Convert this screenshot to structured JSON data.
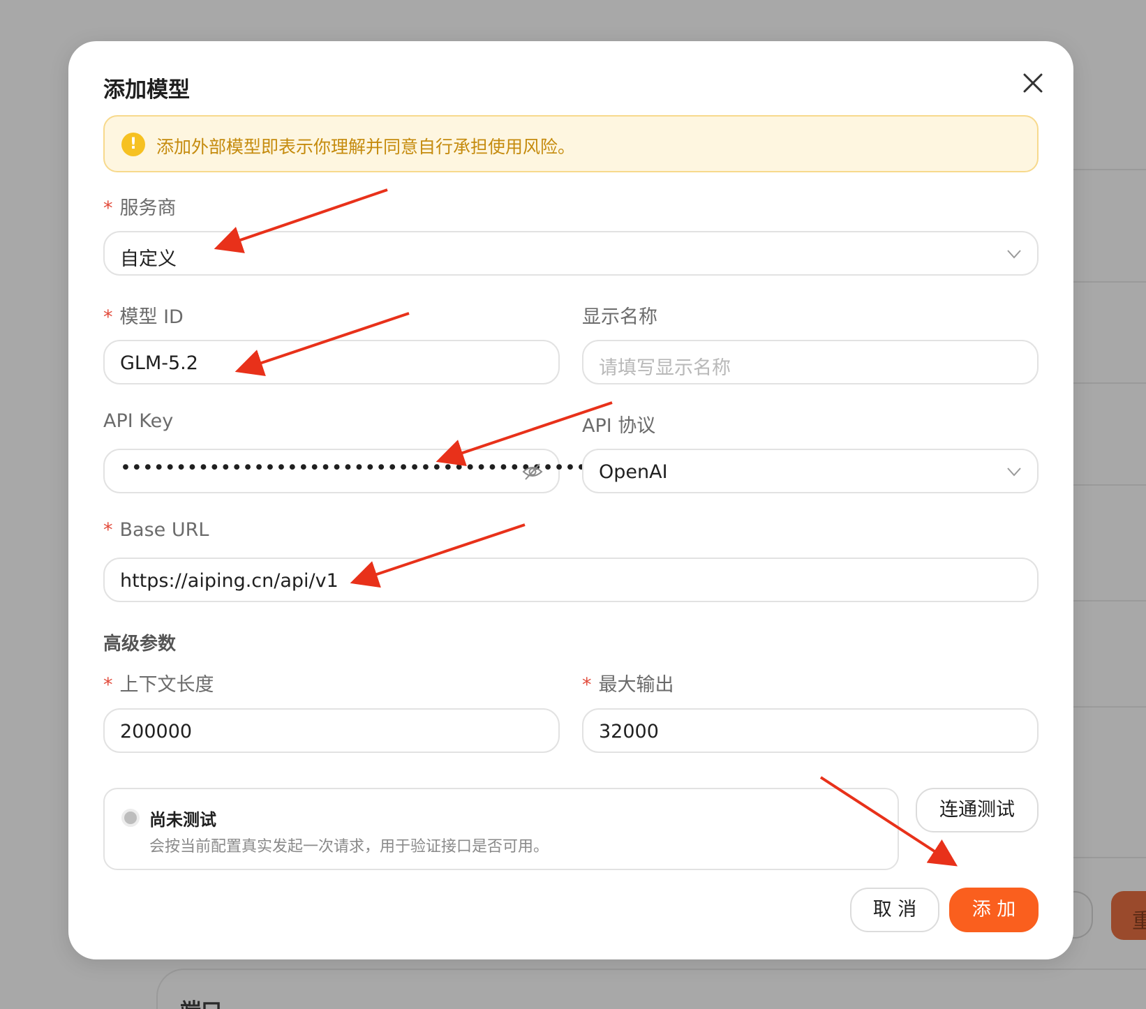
{
  "background": {
    "card_title": "端口",
    "primary_button_fragment": "重"
  },
  "modal": {
    "title": "添加模型",
    "close_icon": "close-icon",
    "alert": {
      "icon": "warning-icon",
      "text": "添加外部模型即表示你理解并同意自行承担使用风险。"
    },
    "fields": {
      "provider": {
        "label": "服务商",
        "required": "*",
        "value": "自定义"
      },
      "model_id": {
        "label": "模型 ID",
        "required": "*",
        "value": "GLM-5.2"
      },
      "display_name": {
        "label": "显示名称",
        "placeholder": "请填写显示名称"
      },
      "api_key": {
        "label": "API Key",
        "masked_value": "••••••••••••••••••••••••••••••••••••••••••••",
        "icon": "eye-off-icon"
      },
      "api_protocol": {
        "label": "API 协议",
        "value": "OpenAI"
      },
      "base_url": {
        "label": "Base URL",
        "required": "*",
        "value": "https://aiping.cn/api/v1"
      }
    },
    "advanced": {
      "title": "高级参数",
      "context_length": {
        "label": "上下文长度",
        "required": "*",
        "value": "200000"
      },
      "max_output": {
        "label": "最大输出",
        "required": "*",
        "value": "32000"
      }
    },
    "status": {
      "title": "尚未测试",
      "description": "会按当前配置真实发起一次请求，用于验证接口是否可用。"
    },
    "buttons": {
      "test": "连通测试",
      "cancel": "取 消",
      "add": "添 加"
    }
  },
  "colors": {
    "primary": "#fa5f1e",
    "required": "#e24b3b",
    "alert_bg": "#fef6e0",
    "alert_text": "#c58b0e",
    "annotation_arrow": "#e8311a"
  }
}
